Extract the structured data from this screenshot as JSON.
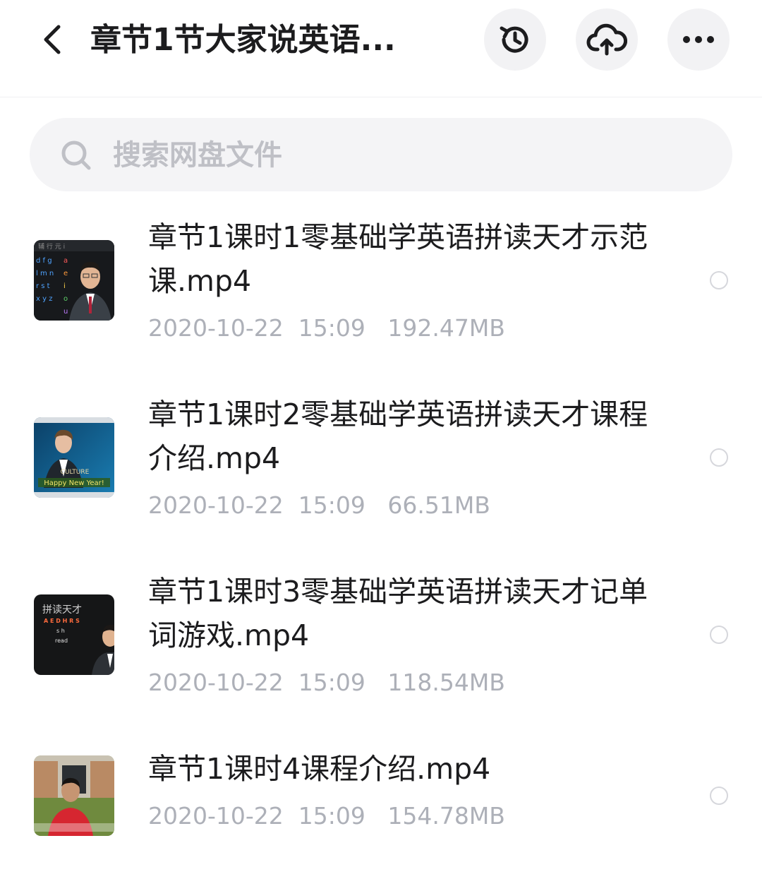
{
  "header": {
    "title": "章节1节大家说英语...",
    "icons": [
      "back-icon",
      "history-icon",
      "cloud-upload-icon",
      "more-icon"
    ]
  },
  "search": {
    "placeholder": "搜索网盘文件"
  },
  "files": [
    {
      "name": "章节1课时1零基础学英语拼读天才示范课.mp4",
      "date": "2020-10-22",
      "time": "15:09",
      "size": "192.47MB",
      "thumb_text": [
        "辅 行 元 i",
        "d f g",
        "l m n",
        "r s t",
        "x y z"
      ],
      "thumb_letters": [
        "a",
        "e",
        "i",
        "o",
        "u"
      ]
    },
    {
      "name": "章节1课时2零基础学英语拼读天才课程介绍.mp4",
      "date": "2020-10-22",
      "time": "15:09",
      "size": "66.51MB",
      "thumb_text": [
        "CULTURE",
        "Happy New Year!"
      ]
    },
    {
      "name": "章节1课时3零基础学英语拼读天才记单词游戏.mp4",
      "date": "2020-10-22",
      "time": "15:09",
      "size": "118.54MB",
      "thumb_text": [
        "拼读天才",
        "A E D H R S",
        "s h",
        "read"
      ]
    },
    {
      "name": "章节1课时4课程介绍.mp4",
      "date": "2020-10-22",
      "time": "15:09",
      "size": "154.78MB"
    }
  ],
  "colors": {
    "text_primary": "#1c1c1e",
    "text_secondary": "#adb0b8",
    "search_bg": "#f4f4f6",
    "button_bg": "#f2f2f4"
  }
}
